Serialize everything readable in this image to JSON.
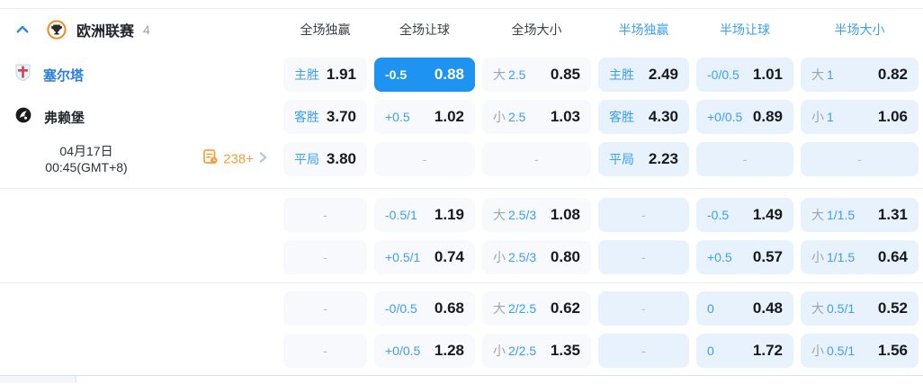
{
  "colors": {
    "accent_blue": "#1e93f0",
    "label_blue": "#3b9ef5",
    "half_cell_bg": "#e8f2fc",
    "full_cell_bg": "#f7f9fc",
    "orange": "#f99d3e",
    "home_team_blue": "#2a7de2"
  },
  "header": {
    "league_name": "欧洲联赛",
    "match_count": "4",
    "columns": [
      "全场独赢",
      "全场让球",
      "全场大小",
      "半场独赢",
      "半场让球",
      "半场大小"
    ]
  },
  "match": {
    "home_team": "塞尔塔",
    "away_team": "弗赖堡",
    "date_line1": "04月17日",
    "date_line2": "00:45(GMT+8)",
    "more_markets_label": "238+"
  },
  "odds": {
    "groups": [
      {
        "rows": [
          {
            "cells": [
              {
                "type": "full",
                "label": "主胜",
                "value": "1.91"
              },
              {
                "type": "selected",
                "label": "-0.5",
                "value": "0.88"
              },
              {
                "type": "full",
                "prefix": "大",
                "line": "2.5",
                "value": "0.85"
              },
              {
                "type": "half",
                "label": "主胜",
                "value": "2.49"
              },
              {
                "type": "half",
                "label": "-0/0.5",
                "value": "1.01"
              },
              {
                "type": "half",
                "prefix": "大",
                "line": "1",
                "value": "0.82"
              }
            ]
          },
          {
            "cells": [
              {
                "type": "full",
                "label": "客胜",
                "value": "3.70"
              },
              {
                "type": "full",
                "label": "+0.5",
                "value": "1.02"
              },
              {
                "type": "full",
                "prefix": "小",
                "line": "2.5",
                "value": "1.03"
              },
              {
                "type": "half",
                "label": "客胜",
                "value": "4.30"
              },
              {
                "type": "half",
                "label": "+0/0.5",
                "value": "0.89"
              },
              {
                "type": "half",
                "prefix": "小",
                "line": "1",
                "value": "1.06"
              }
            ]
          },
          {
            "cells": [
              {
                "type": "full",
                "label": "平局",
                "value": "3.80"
              },
              {
                "type": "full",
                "dash": true
              },
              {
                "type": "full",
                "dash": true
              },
              {
                "type": "half",
                "label": "平局",
                "value": "2.23"
              },
              {
                "type": "half",
                "dash": true
              },
              {
                "type": "half",
                "dash": true
              }
            ]
          }
        ]
      },
      {
        "rows": [
          {
            "cells": [
              {
                "type": "full",
                "dash": true
              },
              {
                "type": "full",
                "label": "-0.5/1",
                "value": "1.19"
              },
              {
                "type": "full",
                "prefix": "大",
                "line": "2.5/3",
                "value": "1.08"
              },
              {
                "type": "half",
                "dash": true
              },
              {
                "type": "half",
                "label": "-0.5",
                "value": "1.49"
              },
              {
                "type": "half",
                "prefix": "大",
                "line": "1/1.5",
                "value": "1.31"
              }
            ]
          },
          {
            "cells": [
              {
                "type": "full",
                "dash": true
              },
              {
                "type": "full",
                "label": "+0.5/1",
                "value": "0.74"
              },
              {
                "type": "full",
                "prefix": "小",
                "line": "2.5/3",
                "value": "0.80"
              },
              {
                "type": "half",
                "dash": true
              },
              {
                "type": "half",
                "label": "+0.5",
                "value": "0.57"
              },
              {
                "type": "half",
                "prefix": "小",
                "line": "1/1.5",
                "value": "0.64"
              }
            ]
          }
        ]
      },
      {
        "rows": [
          {
            "cells": [
              {
                "type": "full",
                "dash": true
              },
              {
                "type": "full",
                "label": "-0/0.5",
                "value": "0.68"
              },
              {
                "type": "full",
                "prefix": "大",
                "line": "2/2.5",
                "value": "0.62"
              },
              {
                "type": "half",
                "dash": true
              },
              {
                "type": "half",
                "label": "0",
                "value": "0.48"
              },
              {
                "type": "half",
                "prefix": "大",
                "line": "0.5/1",
                "value": "0.52"
              }
            ]
          },
          {
            "cells": [
              {
                "type": "full",
                "dash": true
              },
              {
                "type": "full",
                "label": "+0/0.5",
                "value": "1.28"
              },
              {
                "type": "full",
                "prefix": "小",
                "line": "2/2.5",
                "value": "1.35"
              },
              {
                "type": "half",
                "dash": true
              },
              {
                "type": "half",
                "label": "0",
                "value": "1.72"
              },
              {
                "type": "half",
                "prefix": "小",
                "line": "0.5/1",
                "value": "1.56"
              }
            ]
          }
        ]
      }
    ]
  }
}
